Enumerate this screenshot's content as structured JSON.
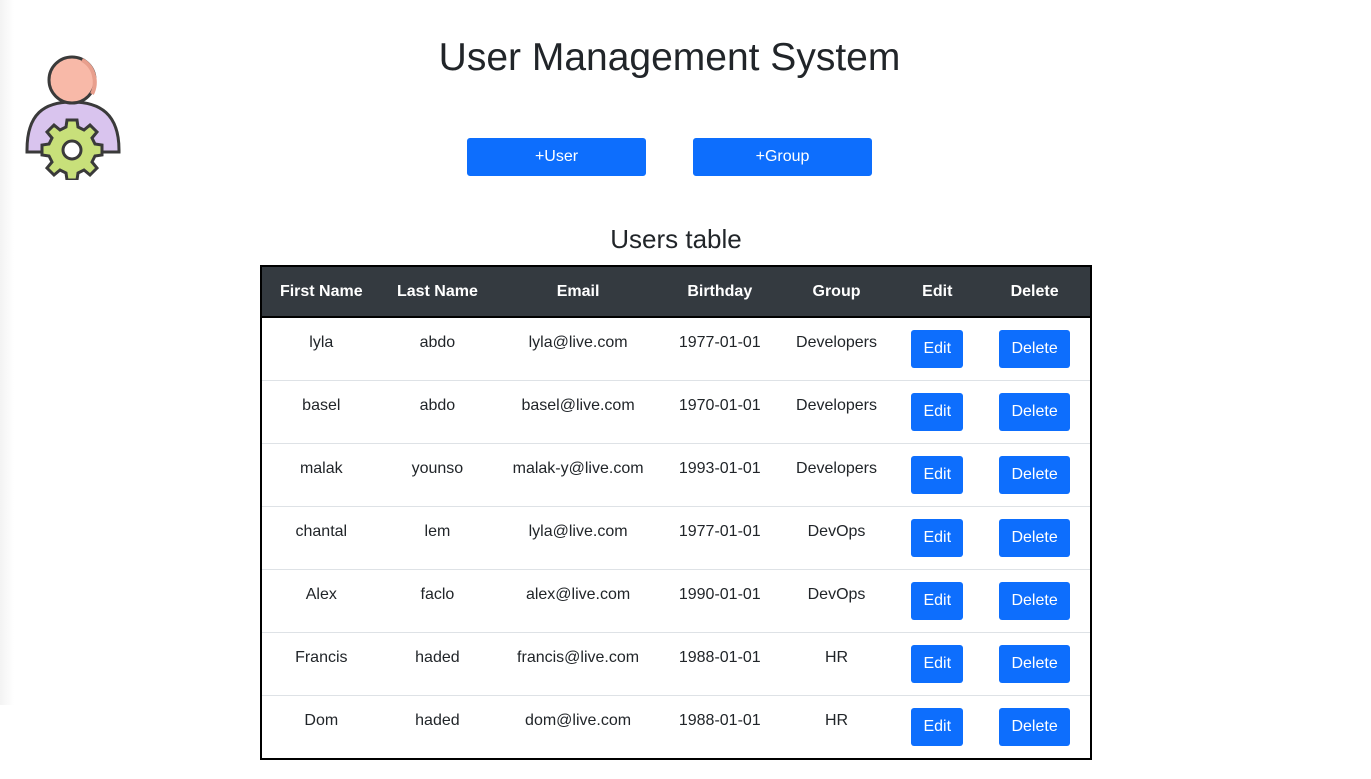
{
  "header": {
    "title": "User Management System",
    "logo_icon": "user-gear-icon"
  },
  "actions": {
    "add_user_label": "+User",
    "add_group_label": "+Group"
  },
  "users_table": {
    "title": "Users table",
    "columns": [
      "First Name",
      "Last Name",
      "Email",
      "Birthday",
      "Group",
      "Edit",
      "Delete"
    ],
    "edit_label": "Edit",
    "delete_label": "Delete",
    "rows": [
      {
        "first": "lyla",
        "last": "abdo",
        "email": "lyla@live.com",
        "birthday": "1977-01-01",
        "group": "Developers"
      },
      {
        "first": "basel",
        "last": "abdo",
        "email": "basel@live.com",
        "birthday": "1970-01-01",
        "group": "Developers"
      },
      {
        "first": "malak",
        "last": "younso",
        "email": "malak-y@live.com",
        "birthday": "1993-01-01",
        "group": "Developers"
      },
      {
        "first": "chantal",
        "last": "lem",
        "email": "lyla@live.com",
        "birthday": "1977-01-01",
        "group": "DevOps"
      },
      {
        "first": "Alex",
        "last": "faclo",
        "email": "alex@live.com",
        "birthday": "1990-01-01",
        "group": "DevOps"
      },
      {
        "first": "Francis",
        "last": "haded",
        "email": "francis@live.com",
        "birthday": "1988-01-01",
        "group": "HR"
      },
      {
        "first": "Dom",
        "last": "haded",
        "email": "dom@live.com",
        "birthday": "1988-01-01",
        "group": "HR"
      }
    ]
  },
  "colors": {
    "primary": "#0d6efd",
    "table_header": "#343a40"
  }
}
